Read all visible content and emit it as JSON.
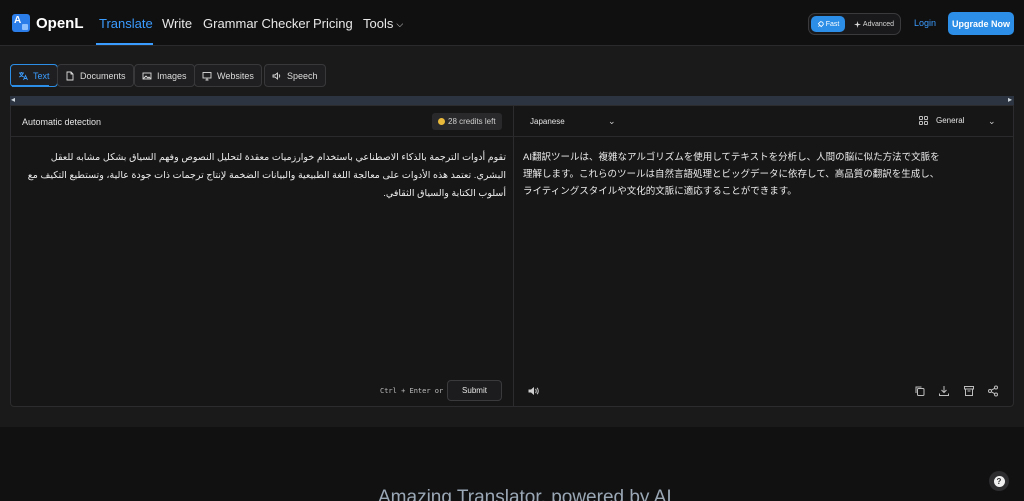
{
  "brand": {
    "name": "OpenL"
  },
  "nav": {
    "items": [
      {
        "label": "Translate",
        "active": true
      },
      {
        "label": "Write"
      },
      {
        "label": "Grammar Checker"
      },
      {
        "label": "Pricing"
      },
      {
        "label": "Tools"
      }
    ],
    "mode": {
      "fast": "Fast",
      "advanced": "Advanced",
      "selected": "Fast"
    },
    "login": "Login",
    "upgrade": "Upgrade Now"
  },
  "tabs": [
    {
      "label": "Text",
      "active": true
    },
    {
      "label": "Documents"
    },
    {
      "label": "Images"
    },
    {
      "label": "Websites"
    },
    {
      "label": "Speech"
    }
  ],
  "translator": {
    "source_language": "Automatic detection",
    "credits": "28 credits left",
    "target_language": "Japanese",
    "style": "General",
    "source_text": "تقوم أدوات الترجمة بالذكاء الاصطناعي باستخدام خوارزميات معقدة لتحليل النصوص وفهم السياق بشكل مشابه للعقل البشري. تعتمد هذه الأدوات على معالجة اللغة الطبيعية والبيانات الضخمة لإنتاج ترجمات ذات جودة عالية، وتستطيع التكيف مع أسلوب الكتابة والسياق الثقافي.",
    "translated_text": "AI翻訳ツールは、複雑なアルゴリズムを使用してテキストを分析し、人間の脳に似た方法で文脈を理解します。これらのツールは自然言語処理とビッグデータに依存して、高品質の翻訳を生成し、ライティングスタイルや文化的文脈に適応することができます。",
    "shortcut": "Ctrl + Enter or",
    "submit": "Submit"
  },
  "footer": {
    "headline": "Amazing Translator, powered by AI"
  },
  "colors": {
    "accent": "#2c8ee6",
    "background": "#1a1a1b",
    "panel": "#161617"
  },
  "icons": [
    "speaker-icon",
    "copy-icon",
    "download-icon",
    "save-icon",
    "share-icon",
    "help-icon"
  ]
}
